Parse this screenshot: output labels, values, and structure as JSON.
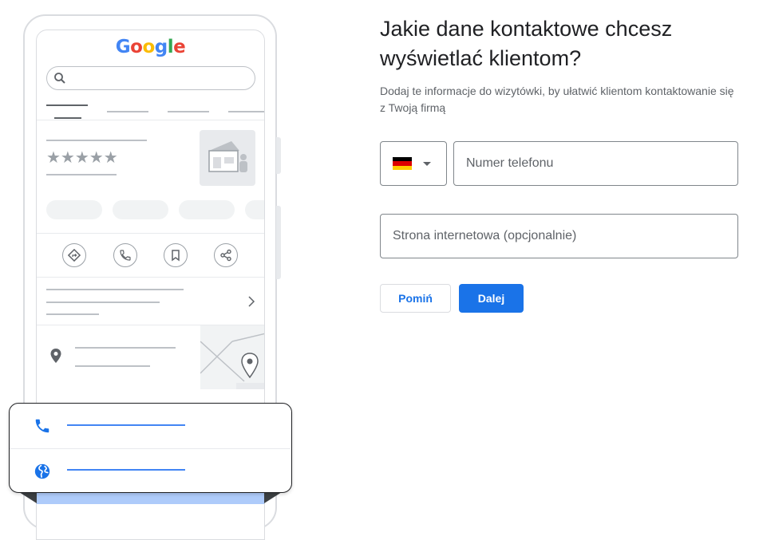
{
  "illustration": {
    "logo_letters": [
      {
        "ch": "G",
        "color": "#4285f4"
      },
      {
        "ch": "o",
        "color": "#ea4335"
      },
      {
        "ch": "o",
        "color": "#fbbc05"
      },
      {
        "ch": "g",
        "color": "#4285f4"
      },
      {
        "ch": "l",
        "color": "#34a853"
      },
      {
        "ch": "e",
        "color": "#ea4335"
      }
    ],
    "stars": "★★★★★",
    "rating_stars": 5,
    "action_icons": [
      "directions-icon",
      "phone-icon",
      "bookmark-icon",
      "share-icon"
    ],
    "popup_icons": [
      "phone-icon",
      "globe-icon"
    ]
  },
  "form": {
    "title": "Jakie dane kontaktowe chcesz wyświetlać klientom?",
    "subtitle": "Dodaj te informacje do wizytówki, by ułatwić klientom kontaktowanie się z Twoją firmą",
    "country_flag": "germany-flag",
    "flag_colors": [
      "#000000",
      "#dd0000",
      "#ffce00"
    ],
    "phone_placeholder": "Numer telefonu",
    "website_placeholder": "Strona internetowa (opcjonalnie)",
    "skip_label": "Pomiń",
    "next_label": "Dalej"
  },
  "colors": {
    "accent": "#1a73e8",
    "popup_accent": "#4285f4"
  }
}
